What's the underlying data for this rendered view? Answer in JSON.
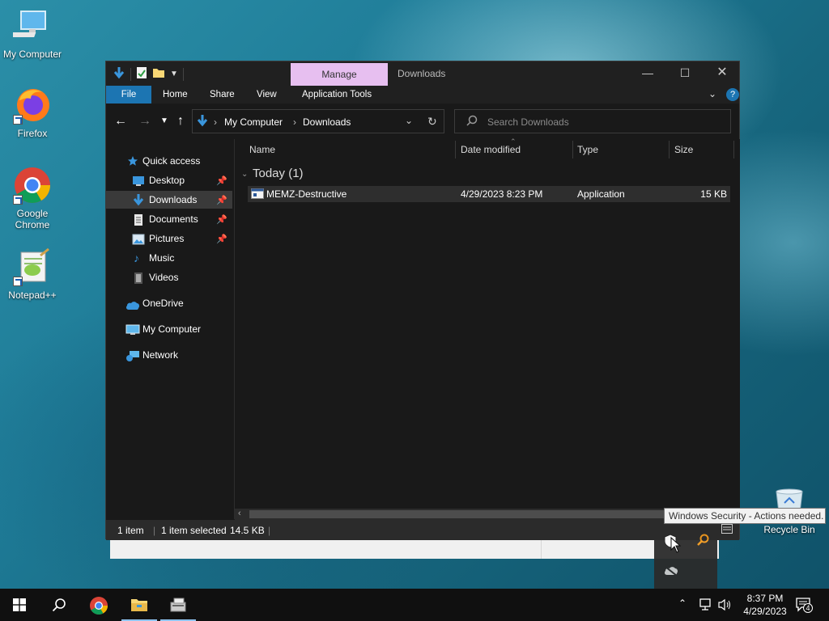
{
  "desktop": {
    "icons": [
      {
        "label": "My Computer"
      },
      {
        "label": "Firefox"
      },
      {
        "label": "Google Chrome"
      },
      {
        "label": "Notepad++"
      },
      {
        "label": "Recycle Bin"
      }
    ]
  },
  "window": {
    "manage_tab": "Manage",
    "title": "Downloads",
    "ribbon_tabs": [
      "File",
      "Home",
      "Share",
      "View",
      "Application Tools"
    ],
    "breadcrumb": [
      "My Computer",
      "Downloads"
    ],
    "search_placeholder": "Search Downloads",
    "nav_items": [
      {
        "label": "Quick access",
        "icon": "star-icon"
      },
      {
        "label": "Desktop",
        "icon": "desktop-folder-icon",
        "pinned": true
      },
      {
        "label": "Downloads",
        "icon": "download-folder-icon",
        "pinned": true,
        "selected": true
      },
      {
        "label": "Documents",
        "icon": "documents-folder-icon",
        "pinned": true
      },
      {
        "label": "Pictures",
        "icon": "pictures-folder-icon",
        "pinned": true
      },
      {
        "label": "Music",
        "icon": "music-folder-icon"
      },
      {
        "label": "Videos",
        "icon": "videos-folder-icon"
      },
      {
        "label": "OneDrive",
        "icon": "cloud-icon"
      },
      {
        "label": "My Computer",
        "icon": "computer-icon"
      },
      {
        "label": "Network",
        "icon": "network-icon"
      }
    ],
    "columns": [
      "Name",
      "Date modified",
      "Type",
      "Size"
    ],
    "group_label": "Today (1)",
    "files": [
      {
        "name": "MEMZ-Destructive",
        "date": "4/29/2023 8:23 PM",
        "type": "Application",
        "size": "15 KB"
      }
    ],
    "status": {
      "count": "1 item",
      "selected": "1 item selected",
      "size": "14.5 KB"
    }
  },
  "tooltip": "Windows Security - Actions needed.",
  "taskbar": {
    "time": "8:37 PM",
    "date": "4/29/2023",
    "notification_count": "4"
  },
  "colors": {
    "file_tab": "#1c75b2",
    "manage_tab": "#e7bff0",
    "window_bg": "#191919"
  }
}
